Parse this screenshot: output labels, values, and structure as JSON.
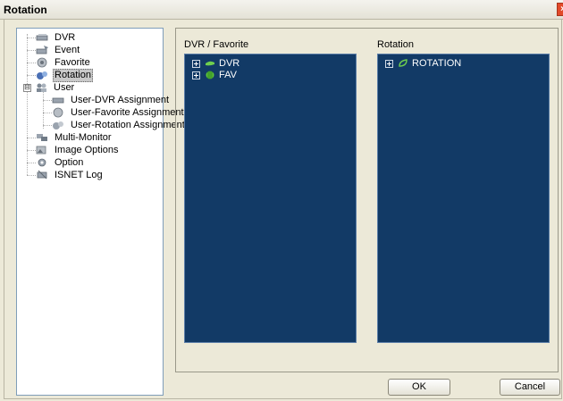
{
  "window": {
    "title": "Rotation",
    "close_glyph": "×"
  },
  "nav": {
    "items": [
      {
        "label": "DVR",
        "icon": "dvr-icon"
      },
      {
        "label": "Event",
        "icon": "event-icon"
      },
      {
        "label": "Favorite",
        "icon": "favorite-icon"
      },
      {
        "label": "Rotation",
        "icon": "rotation-icon",
        "selected": true
      },
      {
        "label": "User",
        "icon": "user-icon",
        "expander": "⊟"
      },
      {
        "label": "User-DVR Assignment",
        "icon": "user-dvr-assignment-icon"
      },
      {
        "label": "User-Favorite Assignment",
        "icon": "user-favorite-assignment-icon"
      },
      {
        "label": "User-Rotation Assignment",
        "icon": "user-rotation-assignment-icon"
      },
      {
        "label": "Multi-Monitor",
        "icon": "multi-monitor-icon"
      },
      {
        "label": "Image Options",
        "icon": "image-options-icon"
      },
      {
        "label": "Option",
        "icon": "option-icon"
      },
      {
        "label": "ISNET Log",
        "icon": "isnet-log-icon"
      }
    ]
  },
  "left_tree": {
    "label": "DVR / Favorite",
    "nodes": [
      {
        "label": "DVR",
        "icon": "dvr-folder-icon"
      },
      {
        "label": "FAV",
        "icon": "favorite-folder-icon"
      }
    ]
  },
  "right_tree": {
    "label": "Rotation",
    "nodes": [
      {
        "label": "ROTATION",
        "icon": "rotation-leaf-icon"
      }
    ]
  },
  "buttons": {
    "ok": "OK",
    "cancel": "Cancel"
  },
  "colors": {
    "tree_bg": "#123a66",
    "dialog_bg": "#ece9d8",
    "selection": "#c9c9c9"
  }
}
